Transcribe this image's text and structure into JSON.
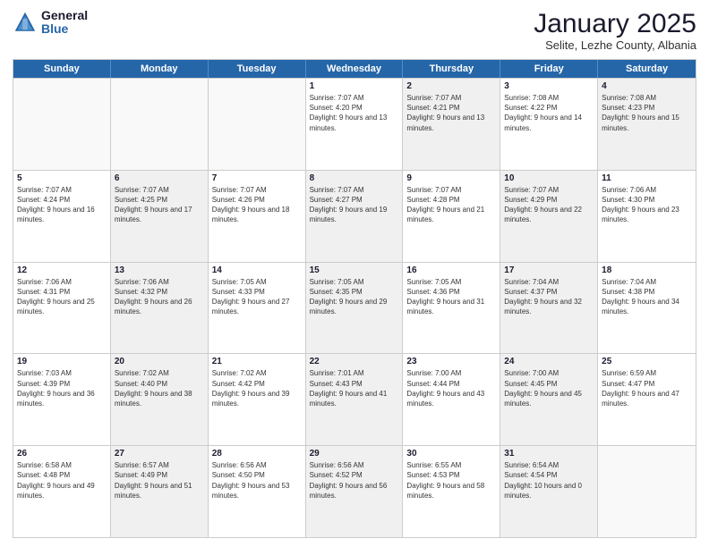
{
  "header": {
    "logo_general": "General",
    "logo_blue": "Blue",
    "month_title": "January 2025",
    "subtitle": "Selite, Lezhe County, Albania"
  },
  "days_of_week": [
    "Sunday",
    "Monday",
    "Tuesday",
    "Wednesday",
    "Thursday",
    "Friday",
    "Saturday"
  ],
  "weeks": [
    [
      {
        "day": "",
        "info": "",
        "shaded": false,
        "empty": true
      },
      {
        "day": "",
        "info": "",
        "shaded": false,
        "empty": true
      },
      {
        "day": "",
        "info": "",
        "shaded": false,
        "empty": true
      },
      {
        "day": "1",
        "info": "Sunrise: 7:07 AM\nSunset: 4:20 PM\nDaylight: 9 hours and 13 minutes.",
        "shaded": false,
        "empty": false
      },
      {
        "day": "2",
        "info": "Sunrise: 7:07 AM\nSunset: 4:21 PM\nDaylight: 9 hours and 13 minutes.",
        "shaded": true,
        "empty": false
      },
      {
        "day": "3",
        "info": "Sunrise: 7:08 AM\nSunset: 4:22 PM\nDaylight: 9 hours and 14 minutes.",
        "shaded": false,
        "empty": false
      },
      {
        "day": "4",
        "info": "Sunrise: 7:08 AM\nSunset: 4:23 PM\nDaylight: 9 hours and 15 minutes.",
        "shaded": true,
        "empty": false
      }
    ],
    [
      {
        "day": "5",
        "info": "Sunrise: 7:07 AM\nSunset: 4:24 PM\nDaylight: 9 hours and 16 minutes.",
        "shaded": false,
        "empty": false
      },
      {
        "day": "6",
        "info": "Sunrise: 7:07 AM\nSunset: 4:25 PM\nDaylight: 9 hours and 17 minutes.",
        "shaded": true,
        "empty": false
      },
      {
        "day": "7",
        "info": "Sunrise: 7:07 AM\nSunset: 4:26 PM\nDaylight: 9 hours and 18 minutes.",
        "shaded": false,
        "empty": false
      },
      {
        "day": "8",
        "info": "Sunrise: 7:07 AM\nSunset: 4:27 PM\nDaylight: 9 hours and 19 minutes.",
        "shaded": true,
        "empty": false
      },
      {
        "day": "9",
        "info": "Sunrise: 7:07 AM\nSunset: 4:28 PM\nDaylight: 9 hours and 21 minutes.",
        "shaded": false,
        "empty": false
      },
      {
        "day": "10",
        "info": "Sunrise: 7:07 AM\nSunset: 4:29 PM\nDaylight: 9 hours and 22 minutes.",
        "shaded": true,
        "empty": false
      },
      {
        "day": "11",
        "info": "Sunrise: 7:06 AM\nSunset: 4:30 PM\nDaylight: 9 hours and 23 minutes.",
        "shaded": false,
        "empty": false
      }
    ],
    [
      {
        "day": "12",
        "info": "Sunrise: 7:06 AM\nSunset: 4:31 PM\nDaylight: 9 hours and 25 minutes.",
        "shaded": false,
        "empty": false
      },
      {
        "day": "13",
        "info": "Sunrise: 7:06 AM\nSunset: 4:32 PM\nDaylight: 9 hours and 26 minutes.",
        "shaded": true,
        "empty": false
      },
      {
        "day": "14",
        "info": "Sunrise: 7:05 AM\nSunset: 4:33 PM\nDaylight: 9 hours and 27 minutes.",
        "shaded": false,
        "empty": false
      },
      {
        "day": "15",
        "info": "Sunrise: 7:05 AM\nSunset: 4:35 PM\nDaylight: 9 hours and 29 minutes.",
        "shaded": true,
        "empty": false
      },
      {
        "day": "16",
        "info": "Sunrise: 7:05 AM\nSunset: 4:36 PM\nDaylight: 9 hours and 31 minutes.",
        "shaded": false,
        "empty": false
      },
      {
        "day": "17",
        "info": "Sunrise: 7:04 AM\nSunset: 4:37 PM\nDaylight: 9 hours and 32 minutes.",
        "shaded": true,
        "empty": false
      },
      {
        "day": "18",
        "info": "Sunrise: 7:04 AM\nSunset: 4:38 PM\nDaylight: 9 hours and 34 minutes.",
        "shaded": false,
        "empty": false
      }
    ],
    [
      {
        "day": "19",
        "info": "Sunrise: 7:03 AM\nSunset: 4:39 PM\nDaylight: 9 hours and 36 minutes.",
        "shaded": false,
        "empty": false
      },
      {
        "day": "20",
        "info": "Sunrise: 7:02 AM\nSunset: 4:40 PM\nDaylight: 9 hours and 38 minutes.",
        "shaded": true,
        "empty": false
      },
      {
        "day": "21",
        "info": "Sunrise: 7:02 AM\nSunset: 4:42 PM\nDaylight: 9 hours and 39 minutes.",
        "shaded": false,
        "empty": false
      },
      {
        "day": "22",
        "info": "Sunrise: 7:01 AM\nSunset: 4:43 PM\nDaylight: 9 hours and 41 minutes.",
        "shaded": true,
        "empty": false
      },
      {
        "day": "23",
        "info": "Sunrise: 7:00 AM\nSunset: 4:44 PM\nDaylight: 9 hours and 43 minutes.",
        "shaded": false,
        "empty": false
      },
      {
        "day": "24",
        "info": "Sunrise: 7:00 AM\nSunset: 4:45 PM\nDaylight: 9 hours and 45 minutes.",
        "shaded": true,
        "empty": false
      },
      {
        "day": "25",
        "info": "Sunrise: 6:59 AM\nSunset: 4:47 PM\nDaylight: 9 hours and 47 minutes.",
        "shaded": false,
        "empty": false
      }
    ],
    [
      {
        "day": "26",
        "info": "Sunrise: 6:58 AM\nSunset: 4:48 PM\nDaylight: 9 hours and 49 minutes.",
        "shaded": false,
        "empty": false
      },
      {
        "day": "27",
        "info": "Sunrise: 6:57 AM\nSunset: 4:49 PM\nDaylight: 9 hours and 51 minutes.",
        "shaded": true,
        "empty": false
      },
      {
        "day": "28",
        "info": "Sunrise: 6:56 AM\nSunset: 4:50 PM\nDaylight: 9 hours and 53 minutes.",
        "shaded": false,
        "empty": false
      },
      {
        "day": "29",
        "info": "Sunrise: 6:56 AM\nSunset: 4:52 PM\nDaylight: 9 hours and 56 minutes.",
        "shaded": true,
        "empty": false
      },
      {
        "day": "30",
        "info": "Sunrise: 6:55 AM\nSunset: 4:53 PM\nDaylight: 9 hours and 58 minutes.",
        "shaded": false,
        "empty": false
      },
      {
        "day": "31",
        "info": "Sunrise: 6:54 AM\nSunset: 4:54 PM\nDaylight: 10 hours and 0 minutes.",
        "shaded": true,
        "empty": false
      },
      {
        "day": "",
        "info": "",
        "shaded": false,
        "empty": true
      }
    ]
  ]
}
